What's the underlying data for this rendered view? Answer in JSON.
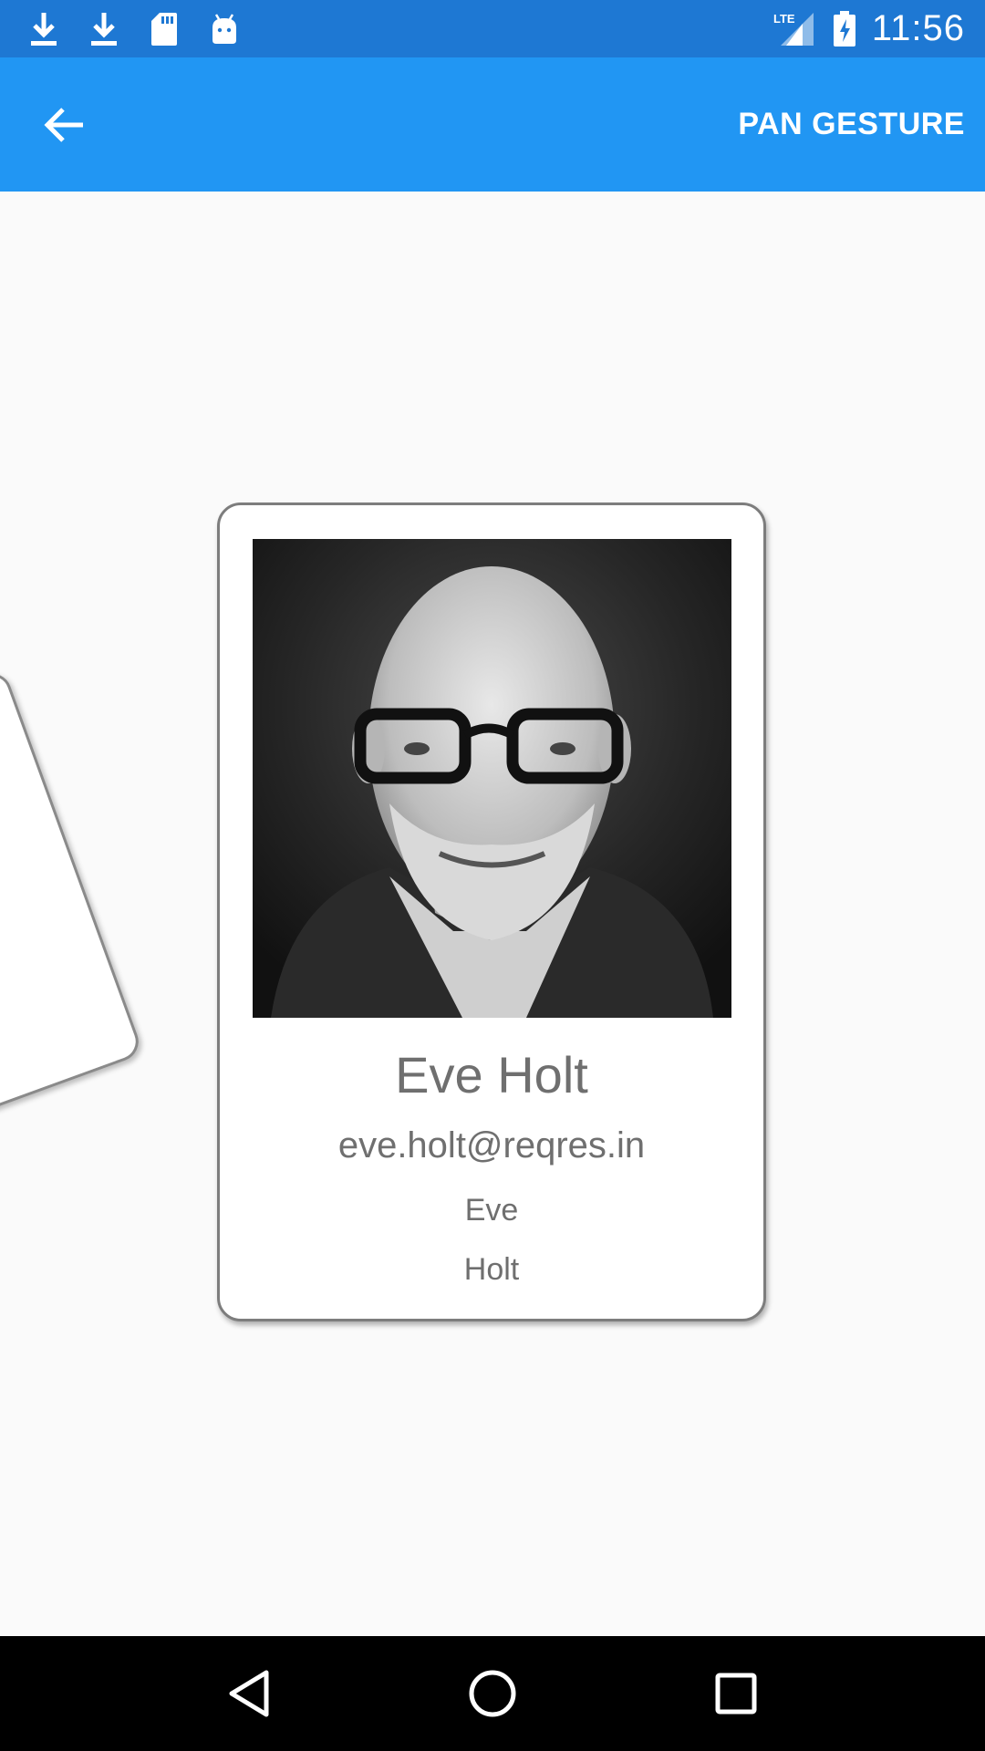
{
  "status_bar": {
    "time": "11:56",
    "icons_left": [
      "download-icon",
      "download-icon",
      "sd-card-icon",
      "android-icon"
    ],
    "icons_right": [
      "lte-signal-icon",
      "battery-charging-icon"
    ],
    "background": "#1e78d3"
  },
  "app_bar": {
    "back_icon": "arrow-left-icon",
    "action_label": "PAN GESTURE",
    "background": "#2196f3"
  },
  "card": {
    "name": "Eve Holt",
    "email": "eve.holt@reqres.in",
    "first_name": "Eve",
    "last_name": "Holt",
    "text_color": "#6f6f6f"
  },
  "nav_bar": {
    "icons": [
      "back-triangle-icon",
      "home-circle-icon",
      "recents-square-icon"
    ]
  }
}
